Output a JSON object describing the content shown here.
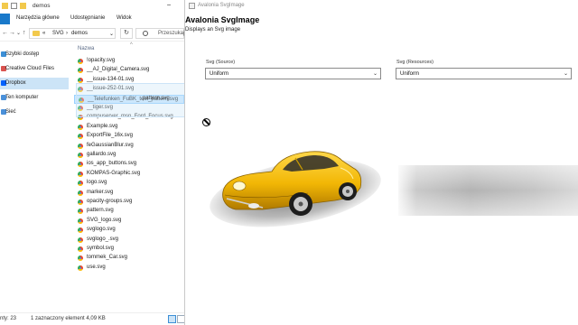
{
  "explorer": {
    "title": "demos",
    "ribbon_tabs": [
      "Narzędzia główne",
      "Udostępnianie",
      "Widok"
    ],
    "nav_back": "←",
    "nav_forward": "→",
    "nav_recent": "⌄",
    "nav_up": "↑",
    "breadcrumb": [
      "«",
      "SVG",
      "›",
      "demos"
    ],
    "breadcrumb_dropdown": "⌄",
    "refresh": "↻",
    "search_placeholder": "Przeszukaj",
    "sidebar": [
      {
        "label": "Szybki dostęp",
        "icon": "star-icon",
        "color": "#3c8fd6",
        "selected": false
      },
      {
        "label": "Creative Cloud Files",
        "icon": "creative-cloud-icon",
        "color": "#d9534f",
        "selected": false
      },
      {
        "label": "Dropbox",
        "icon": "dropbox-icon",
        "color": "#0061fe",
        "selected": true
      },
      {
        "label": "Ten komputer",
        "icon": "computer-icon",
        "color": "#4a90d9",
        "selected": false
      },
      {
        "label": "Sieć",
        "icon": "network-icon",
        "color": "#4a90d9",
        "selected": false
      }
    ],
    "column_header": "Nazwa",
    "sort_indicator": "^",
    "files": [
      "!opacity.svg",
      "__AJ_Digital_Camera.svg",
      "__issue-134-01.svg",
      "__issue-252-01.svg",
      "__Telefunken_FuBK_test_pattern.svg",
      "__tiger.svg",
      "compuserver_msn_Ford_Focus.svg",
      "Example.svg",
      "ExportFile_16x.svg",
      "feGaussianBlur.svg",
      "gallardo.svg",
      "ios_app_buttons.svg",
      "KOMPAS-Graphic.svg",
      "logo.svg",
      "marker.svg",
      "opacity-groups.svg",
      "pattern.svg",
      "SVG_logo.svg",
      "svglogo.svg",
      "svglogo_.svg",
      "symbol.svg",
      "tommek_Car.svg",
      "use.svg"
    ],
    "selected_file_index": 4,
    "drag_label": "pattern.svg",
    "status_count": "nty: 23",
    "status_selected": "1 zaznaczony element  4,09 KB"
  },
  "avalonia": {
    "window_title": "Avalonia SvgImage",
    "heading": "Avalonia SvgImage",
    "subtitle": "Displays an Svg image",
    "source_label": "Svg (Source)",
    "source_value": "Uniform",
    "resources_label": "Svg (Resources)",
    "resources_value": "Uniform",
    "dropdown_arrow": "⌄"
  }
}
